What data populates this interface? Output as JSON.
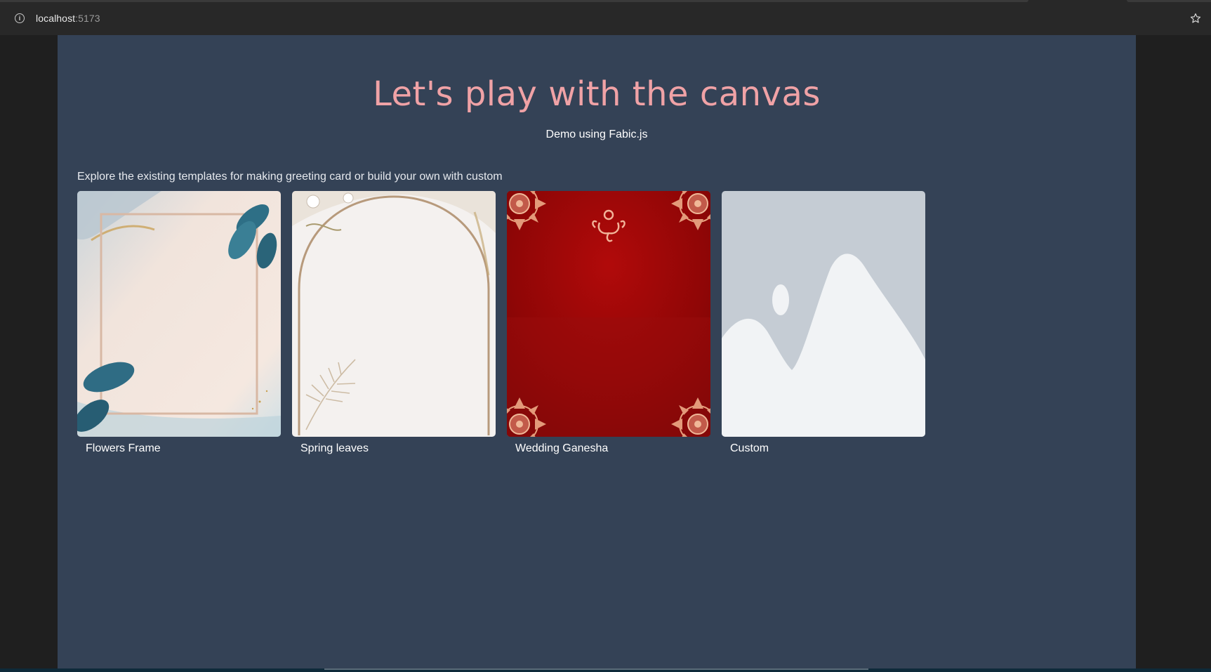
{
  "browser": {
    "url_host": "localhost",
    "url_port": ":5173",
    "info_icon": "info-icon",
    "bookmark_icon": "star-icon"
  },
  "page": {
    "title": "Let's play with the canvas",
    "subtitle": "Demo using Fabic.js",
    "intro": "Explore the existing templates for making greeting card or build your own with custom"
  },
  "templates": [
    {
      "label": "Flowers Frame",
      "thumbnail": "flowers-frame-thumbnail"
    },
    {
      "label": "Spring leaves",
      "thumbnail": "spring-leaves-thumbnail"
    },
    {
      "label": "Wedding Ganesha",
      "thumbnail": "wedding-ganesha-thumbnail"
    },
    {
      "label": "Custom",
      "thumbnail": "image-placeholder-icon"
    }
  ],
  "colors": {
    "page_background": "#344256",
    "title": "#f0a2a6",
    "browser_chrome": "#282828"
  }
}
